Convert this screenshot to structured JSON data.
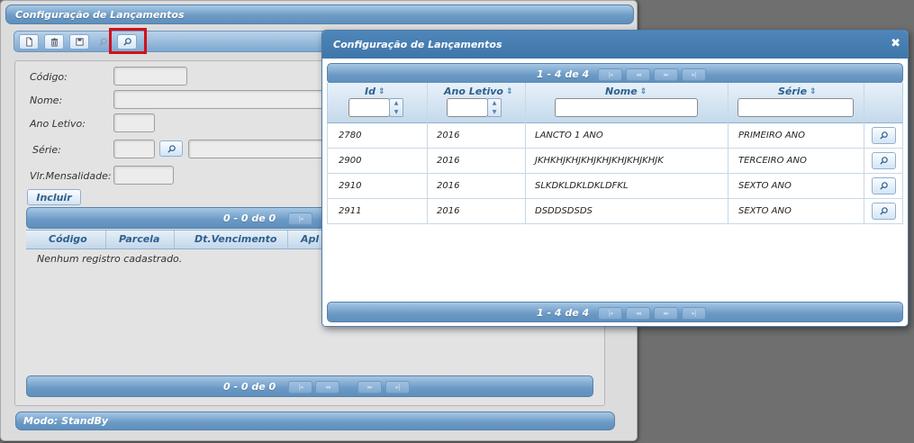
{
  "main_window": {
    "title": "Configuração de Lançamentos",
    "toolbar": {
      "buttons": [
        {
          "name": "new-document",
          "icon": "new-document-icon"
        },
        {
          "name": "delete",
          "icon": "trash-icon"
        },
        {
          "name": "save",
          "icon": "floppy-disk-icon"
        },
        {
          "name": "search-disabled",
          "icon": "search-icon"
        },
        {
          "name": "search",
          "icon": "search-icon",
          "highlighted": true
        }
      ]
    },
    "form": {
      "codigo_label": "Código:",
      "nome_label": "Nome:",
      "ano_letivo_label": "Ano Letivo:",
      "serie_label": "Série:",
      "vlr_mensalidade_label": "Vlr.Mensalidade:",
      "incluir_label": "Incluir"
    },
    "grid": {
      "pager_text": "0 - 0 de 0",
      "columns": [
        "Código",
        "Parcela",
        "Dt.Vencimento",
        "Apl"
      ],
      "empty_text": "Nenhum registro cadastrado.",
      "pager_bottom_text": "0 - 0 de 0"
    },
    "status": "Modo: StandBy"
  },
  "dialog": {
    "title": "Configuração de Lançamentos",
    "close_glyph": "✖",
    "pager_top": "1 - 4 de 4",
    "pager_bottom": "1 - 4 de 4",
    "pager_glyphs": [
      "|◂",
      "◂◂",
      "▸▸",
      "▸|"
    ],
    "columns": [
      "Id",
      "Ano Letivo",
      "Nome",
      "Série"
    ],
    "rows": [
      {
        "id": "2780",
        "ano": "2016",
        "nome": "LANCTO 1 ANO",
        "serie": "PRIMEIRO ANO"
      },
      {
        "id": "2900",
        "ano": "2016",
        "nome": "JKHKHJKHJKHJKHJKHJKHJKHJK",
        "serie": "TERCEIRO ANO"
      },
      {
        "id": "2910",
        "ano": "2016",
        "nome": "SLKDKLDKLDKLDFKL",
        "serie": "SEXTO ANO"
      },
      {
        "id": "2911",
        "ano": "2016",
        "nome": "DSDDSDSDS",
        "serie": "SEXTO ANO"
      }
    ]
  },
  "colors": {
    "accent_blue": "#6e9cc6",
    "dialog_title_blue": "#3f76aa",
    "highlight_red": "#d3101c",
    "background_gray": "#6f6f6f"
  }
}
